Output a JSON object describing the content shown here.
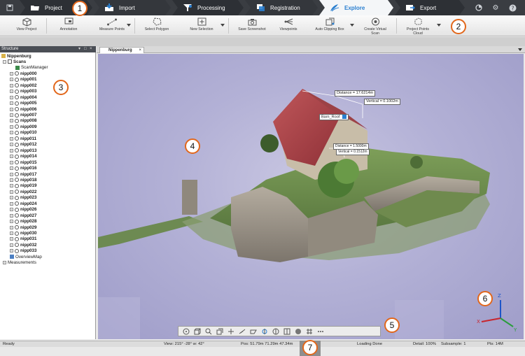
{
  "tabs": [
    {
      "label": "Project",
      "icon": "folder-icon"
    },
    {
      "label": "Import",
      "icon": "import-icon"
    },
    {
      "label": "Processing",
      "icon": "funnel-icon"
    },
    {
      "label": "Registration",
      "icon": "registration-icon"
    },
    {
      "label": "Explore",
      "icon": "explore-icon",
      "active": true
    },
    {
      "label": "Export",
      "icon": "export-icon"
    }
  ],
  "ribbon": {
    "view_project": "View Project",
    "annotation": "Annotation",
    "measure_points": "Measure Points",
    "select_polygon": "Select Polygon",
    "new_selection": "New Selection",
    "save_screenshot": "Save Screenshot",
    "viewpoints": "Viewpoints",
    "auto_clipping_box": "Auto Clipping Box",
    "create_virtual_scan": "Create Virtual Scan",
    "project_points_cloud": "Project Points Cloud"
  },
  "structure": {
    "title": "Structure",
    "root": "Nippenburg",
    "scans_label": "Scans",
    "scan_manager": "ScanManager",
    "scans": [
      "nipp000",
      "nipp001",
      "nipp002",
      "nipp003",
      "nipp004",
      "nipp005",
      "nipp006",
      "nipp007",
      "nipp008",
      "nipp009",
      "nipp010",
      "nipp011",
      "nipp012",
      "nipp013",
      "nipp014",
      "nipp015",
      "nipp016",
      "nipp017",
      "nipp018",
      "nipp019",
      "nipp022",
      "nipp023",
      "nipp024",
      "nipp026",
      "nipp027",
      "nipp028",
      "nipp029",
      "nipp030",
      "nipp031",
      "nipp032",
      "nipp033"
    ],
    "overview_map": "OverviewMap",
    "measurements": "Measurements"
  },
  "viewport": {
    "tab_label": "Nippenburg",
    "measurements": {
      "distance": "Distance = 17.6214m",
      "vertical1": "Vertical = 0.1002m",
      "barn_roof": "Barn_Roof",
      "distance2": "Distance = 1.5000m",
      "vertical2": "Vertical = 0.1512m"
    }
  },
  "status": {
    "ready": "Ready",
    "view": "View: 215° -28° w: 42°",
    "pos": "Pos: 51.79m 71.29m 47.34m",
    "loading": "Loading Done",
    "detail": "Detail: 100%",
    "subsample": "Subsample:  1",
    "pts": "Pts: 14M"
  },
  "callouts": [
    "1",
    "2",
    "3",
    "4",
    "5",
    "6",
    "7"
  ],
  "axes": {
    "z": "Z",
    "x": "X",
    "y": "Y"
  },
  "colors": {
    "accent": "#2a7fd0",
    "callout": "#e2671b",
    "tabbar": "#3a3d42"
  }
}
